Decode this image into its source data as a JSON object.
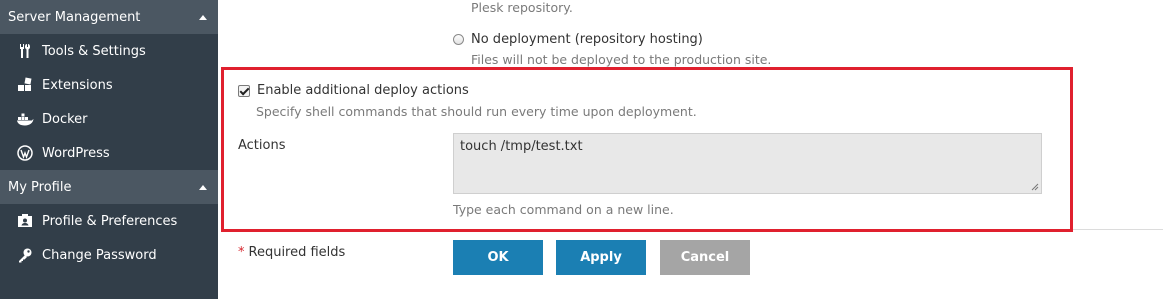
{
  "sidebar": {
    "server_management": {
      "label": "Server Management",
      "items": [
        {
          "label": "Tools & Settings",
          "icon": "tools-icon"
        },
        {
          "label": "Extensions",
          "icon": "extensions-icon"
        },
        {
          "label": "Docker",
          "icon": "docker-icon"
        },
        {
          "label": "WordPress",
          "icon": "wordpress-icon"
        }
      ]
    },
    "my_profile": {
      "label": "My Profile",
      "items": [
        {
          "label": "Profile & Preferences",
          "icon": "profile-icon"
        },
        {
          "label": "Change Password",
          "icon": "key-icon"
        }
      ]
    }
  },
  "deployment": {
    "prev_hint": "Plesk repository.",
    "no_deploy_label": "No deployment (repository hosting)",
    "no_deploy_hint": "Files will not be deployed to the production site."
  },
  "deploy_actions": {
    "checkbox_label": "Enable additional deploy actions",
    "checkbox_checked": true,
    "hint": "Specify shell commands that should run every time upon deployment.",
    "actions_label": "Actions",
    "actions_value": "touch /tmp/test.txt",
    "actions_hint": "Type each command on a new line."
  },
  "footer": {
    "required_star": "*",
    "required_label": "Required fields",
    "ok_label": "OK",
    "apply_label": "Apply",
    "cancel_label": "Cancel"
  },
  "colors": {
    "sidebar_bg": "#323e49",
    "sidebar_header_bg": "#4b5762",
    "primary_button": "#1b7fb3",
    "cancel_button": "#a5a5a5",
    "highlight_border": "#e0202e"
  }
}
